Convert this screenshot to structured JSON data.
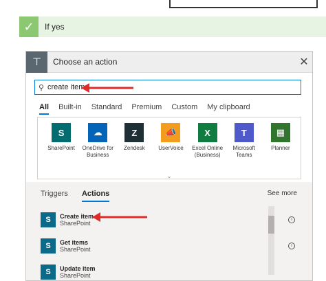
{
  "condition": {
    "label": "If yes"
  },
  "dialog": {
    "title": "Choose an action",
    "close_glyph": "✕"
  },
  "search": {
    "value": "create item"
  },
  "filter_tabs": [
    {
      "label": "All",
      "active": true
    },
    {
      "label": "Built-in",
      "active": false
    },
    {
      "label": "Standard",
      "active": false
    },
    {
      "label": "Premium",
      "active": false
    },
    {
      "label": "Custom",
      "active": false
    },
    {
      "label": "My clipboard",
      "active": false
    }
  ],
  "connectors": [
    {
      "name": "SharePoint",
      "glyph": "S",
      "color": "#036c70"
    },
    {
      "name": "OneDrive for Business",
      "glyph": "☁",
      "color": "#0364b8"
    },
    {
      "name": "Zendesk",
      "glyph": "Z",
      "color": "#1f2f36"
    },
    {
      "name": "UserVoice",
      "glyph": "📣",
      "color": "#f49c1e"
    },
    {
      "name": "Excel Online (Business)",
      "glyph": "X",
      "color": "#107c41"
    },
    {
      "name": "Microsoft Teams",
      "glyph": "T",
      "color": "#5059c9"
    },
    {
      "name": "Planner",
      "glyph": "▦",
      "color": "#31752f"
    }
  ],
  "action_tabs": {
    "triggers": "Triggers",
    "actions": "Actions",
    "see_more": "See more"
  },
  "actions": [
    {
      "name": "Create item",
      "connector": "SharePoint"
    },
    {
      "name": "Get items",
      "connector": "SharePoint"
    },
    {
      "name": "Update item",
      "connector": "SharePoint"
    }
  ],
  "colors": {
    "accent": "#0078d4",
    "arrow": "#e02b2b",
    "success": "#8cc872"
  }
}
